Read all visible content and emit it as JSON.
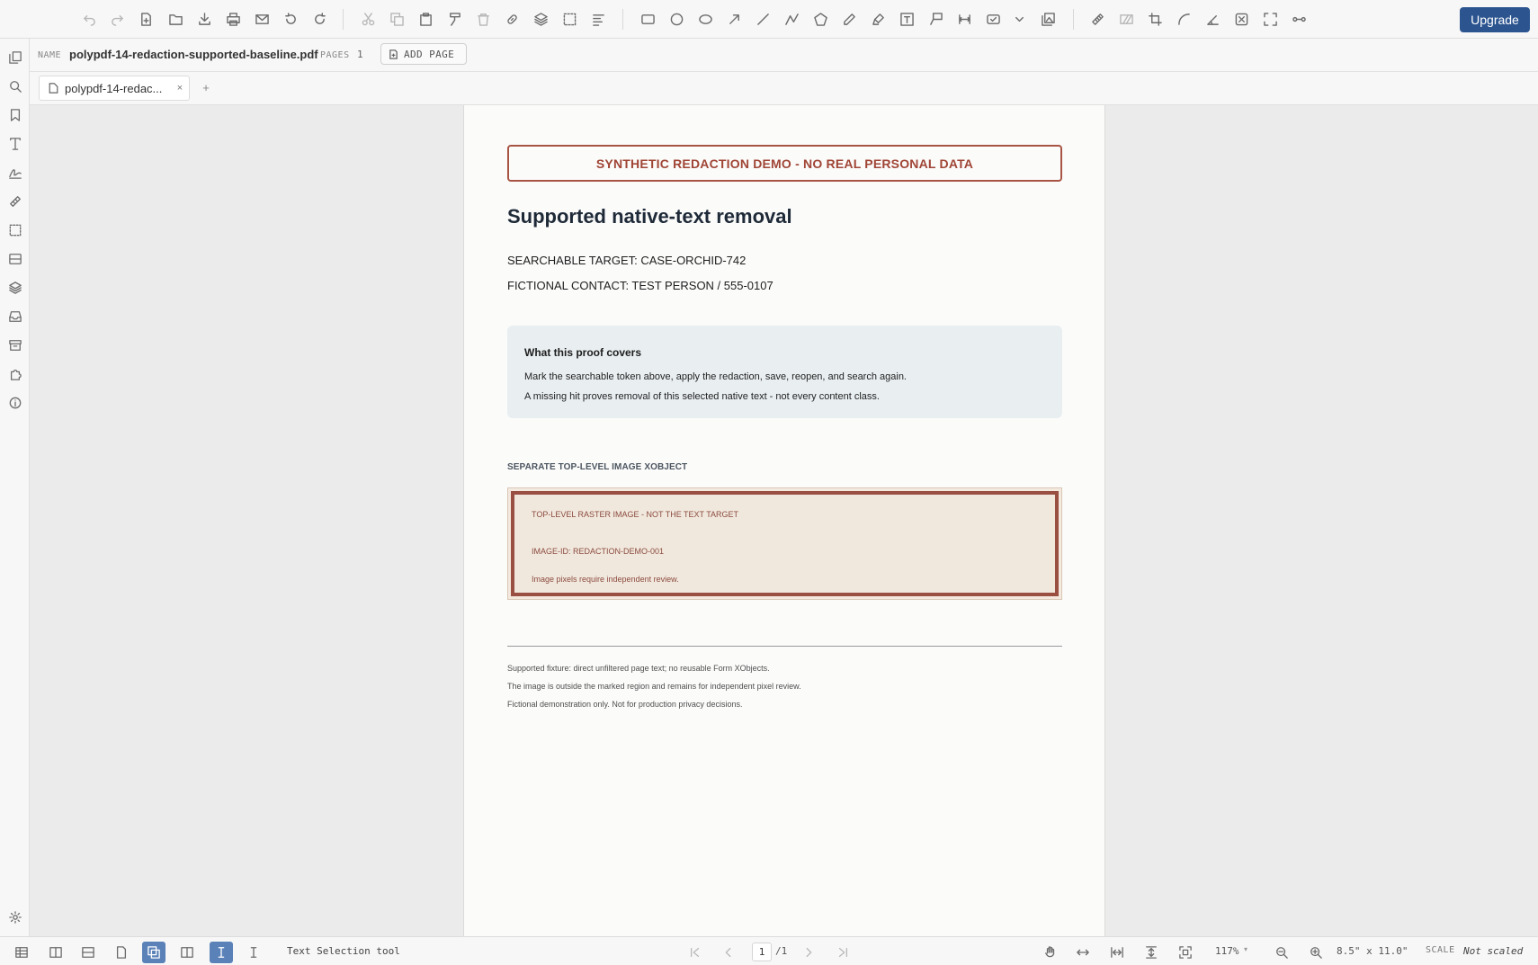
{
  "toolbar": {
    "upgrade_label": "Upgrade"
  },
  "document": {
    "name_label": "NAME",
    "name": "polypdf-14-redaction-supported-baseline.pdf",
    "pages_label": "PAGES",
    "pages": "1",
    "add_page_label": "ADD PAGE"
  },
  "tabs": [
    {
      "title": "polypdf-14-redac...",
      "close": "×"
    }
  ],
  "tab_add": "+",
  "page": {
    "banner": "SYNTHETIC REDACTION DEMO - NO REAL PERSONAL DATA",
    "title": "Supported native-text removal",
    "line1": "SEARCHABLE TARGET: CASE-ORCHID-742",
    "line2": "FICTIONAL CONTACT: TEST PERSON / 555-0107",
    "info_title": "What this proof covers",
    "info_line1": "Mark the searchable token above, apply the redaction, save, reopen, and search again.",
    "info_line2": "A missing hit proves removal of this selected native text - not every content class.",
    "image_caption": "SEPARATE TOP-LEVEL IMAGE XOBJECT",
    "image_line1": "TOP-LEVEL RASTER IMAGE - NOT THE TEXT TARGET",
    "image_line2": "IMAGE-ID: REDACTION-DEMO-001",
    "image_line3": "Image pixels require independent review.",
    "footer1": "Supported fixture: direct unfiltered page text; no reusable Form XObjects.",
    "footer2": "The image is outside the marked region and remains for independent pixel review.",
    "footer3": "Fictional demonstration only. Not for production privacy decisions."
  },
  "status": {
    "mode": "Text Selection tool",
    "page_current": "1",
    "page_total": "/1",
    "zoom": "117%",
    "dimensions": "8.5\" x 11.0\"",
    "scale_label": "SCALE",
    "scale_value": "Not scaled"
  },
  "colors": {
    "accent": "#2c5590",
    "active_tool": "#5b82b8",
    "redaction_red": "#a04535"
  }
}
